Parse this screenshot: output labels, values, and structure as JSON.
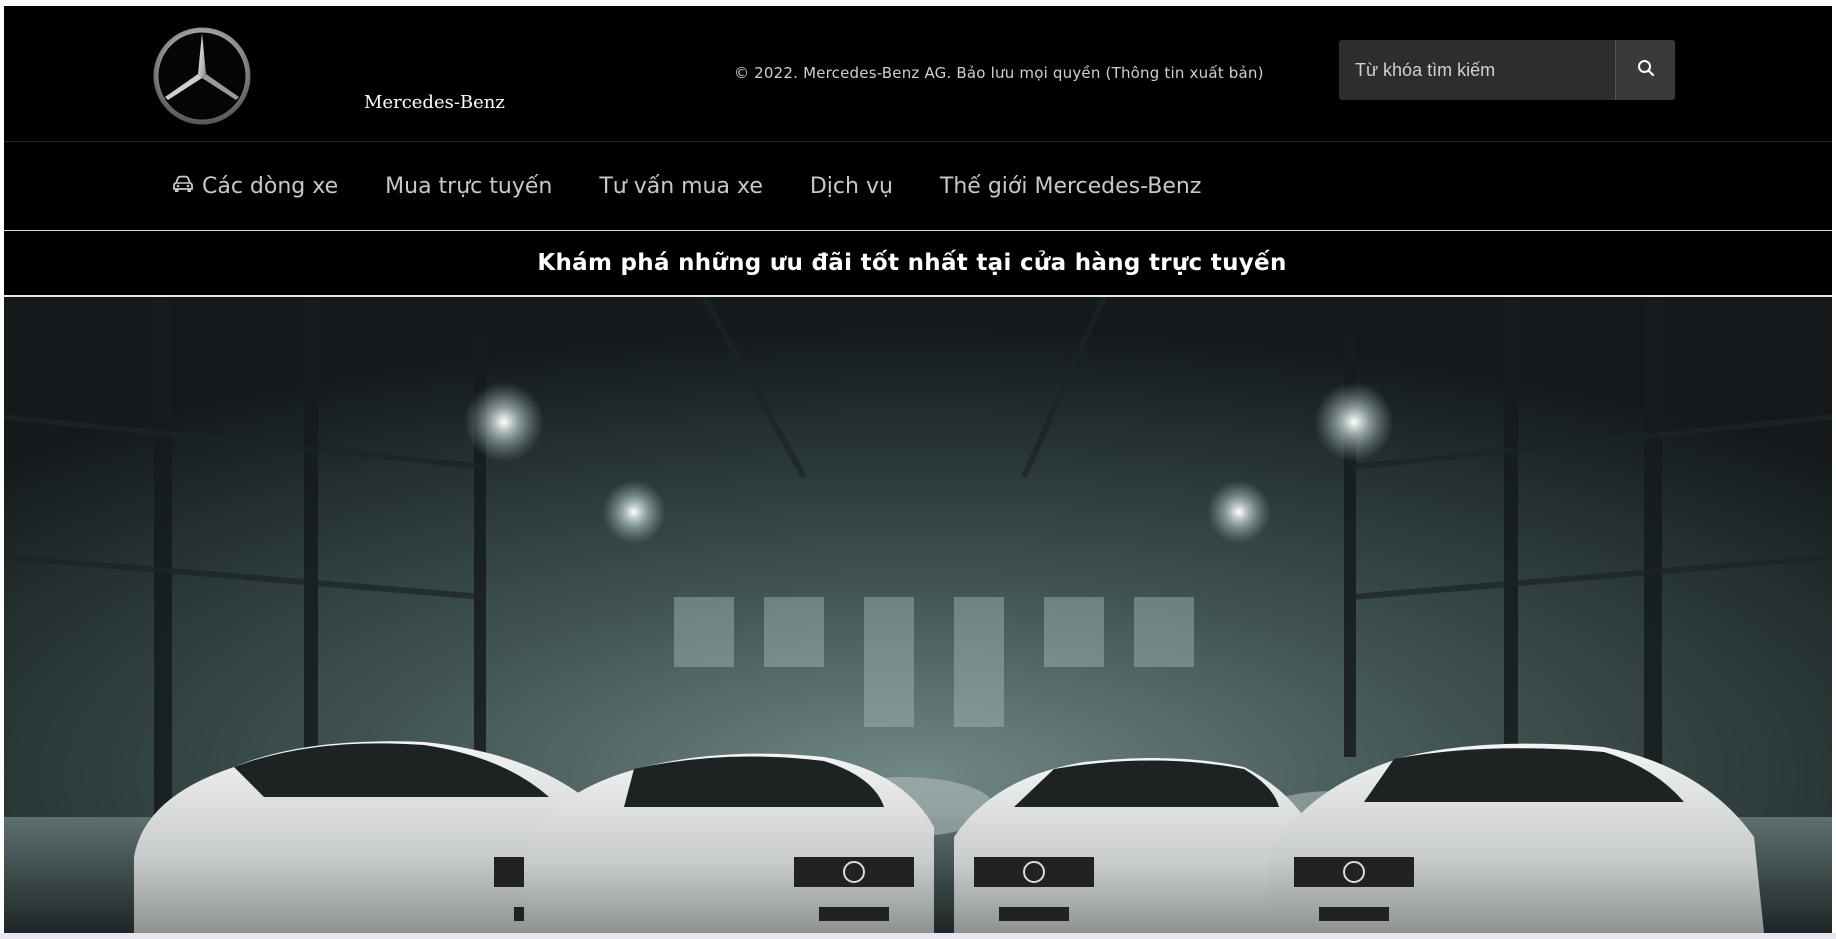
{
  "header": {
    "logo_icon": "mercedes-star-icon",
    "brand": "Mercedes-Benz",
    "copyright": "© 2022. Mercedes-Benz AG. Bảo lưu mọi quyền (Thông tin xuất bản)",
    "search": {
      "placeholder": "Từ khóa tìm kiếm",
      "button_icon": "search-icon"
    }
  },
  "nav": {
    "items": [
      {
        "label": "Các dòng xe",
        "icon": "car-icon"
      },
      {
        "label": "Mua trực tuyến"
      },
      {
        "label": "Tư vấn mua xe"
      },
      {
        "label": "Dịch vụ"
      },
      {
        "label": "Thế giới Mercedes-Benz"
      }
    ]
  },
  "promo": {
    "text": "Khám phá những ưu đãi tốt nhất tại cửa hàng trực tuyến"
  },
  "hero": {
    "image": "four-white-mercedes-amg-cars-in-dark-warehouse"
  },
  "colors": {
    "background": "#000000",
    "text": "#ffffff",
    "nav_text": "#c8c8c8",
    "search_bg": "#2d2d2d"
  }
}
